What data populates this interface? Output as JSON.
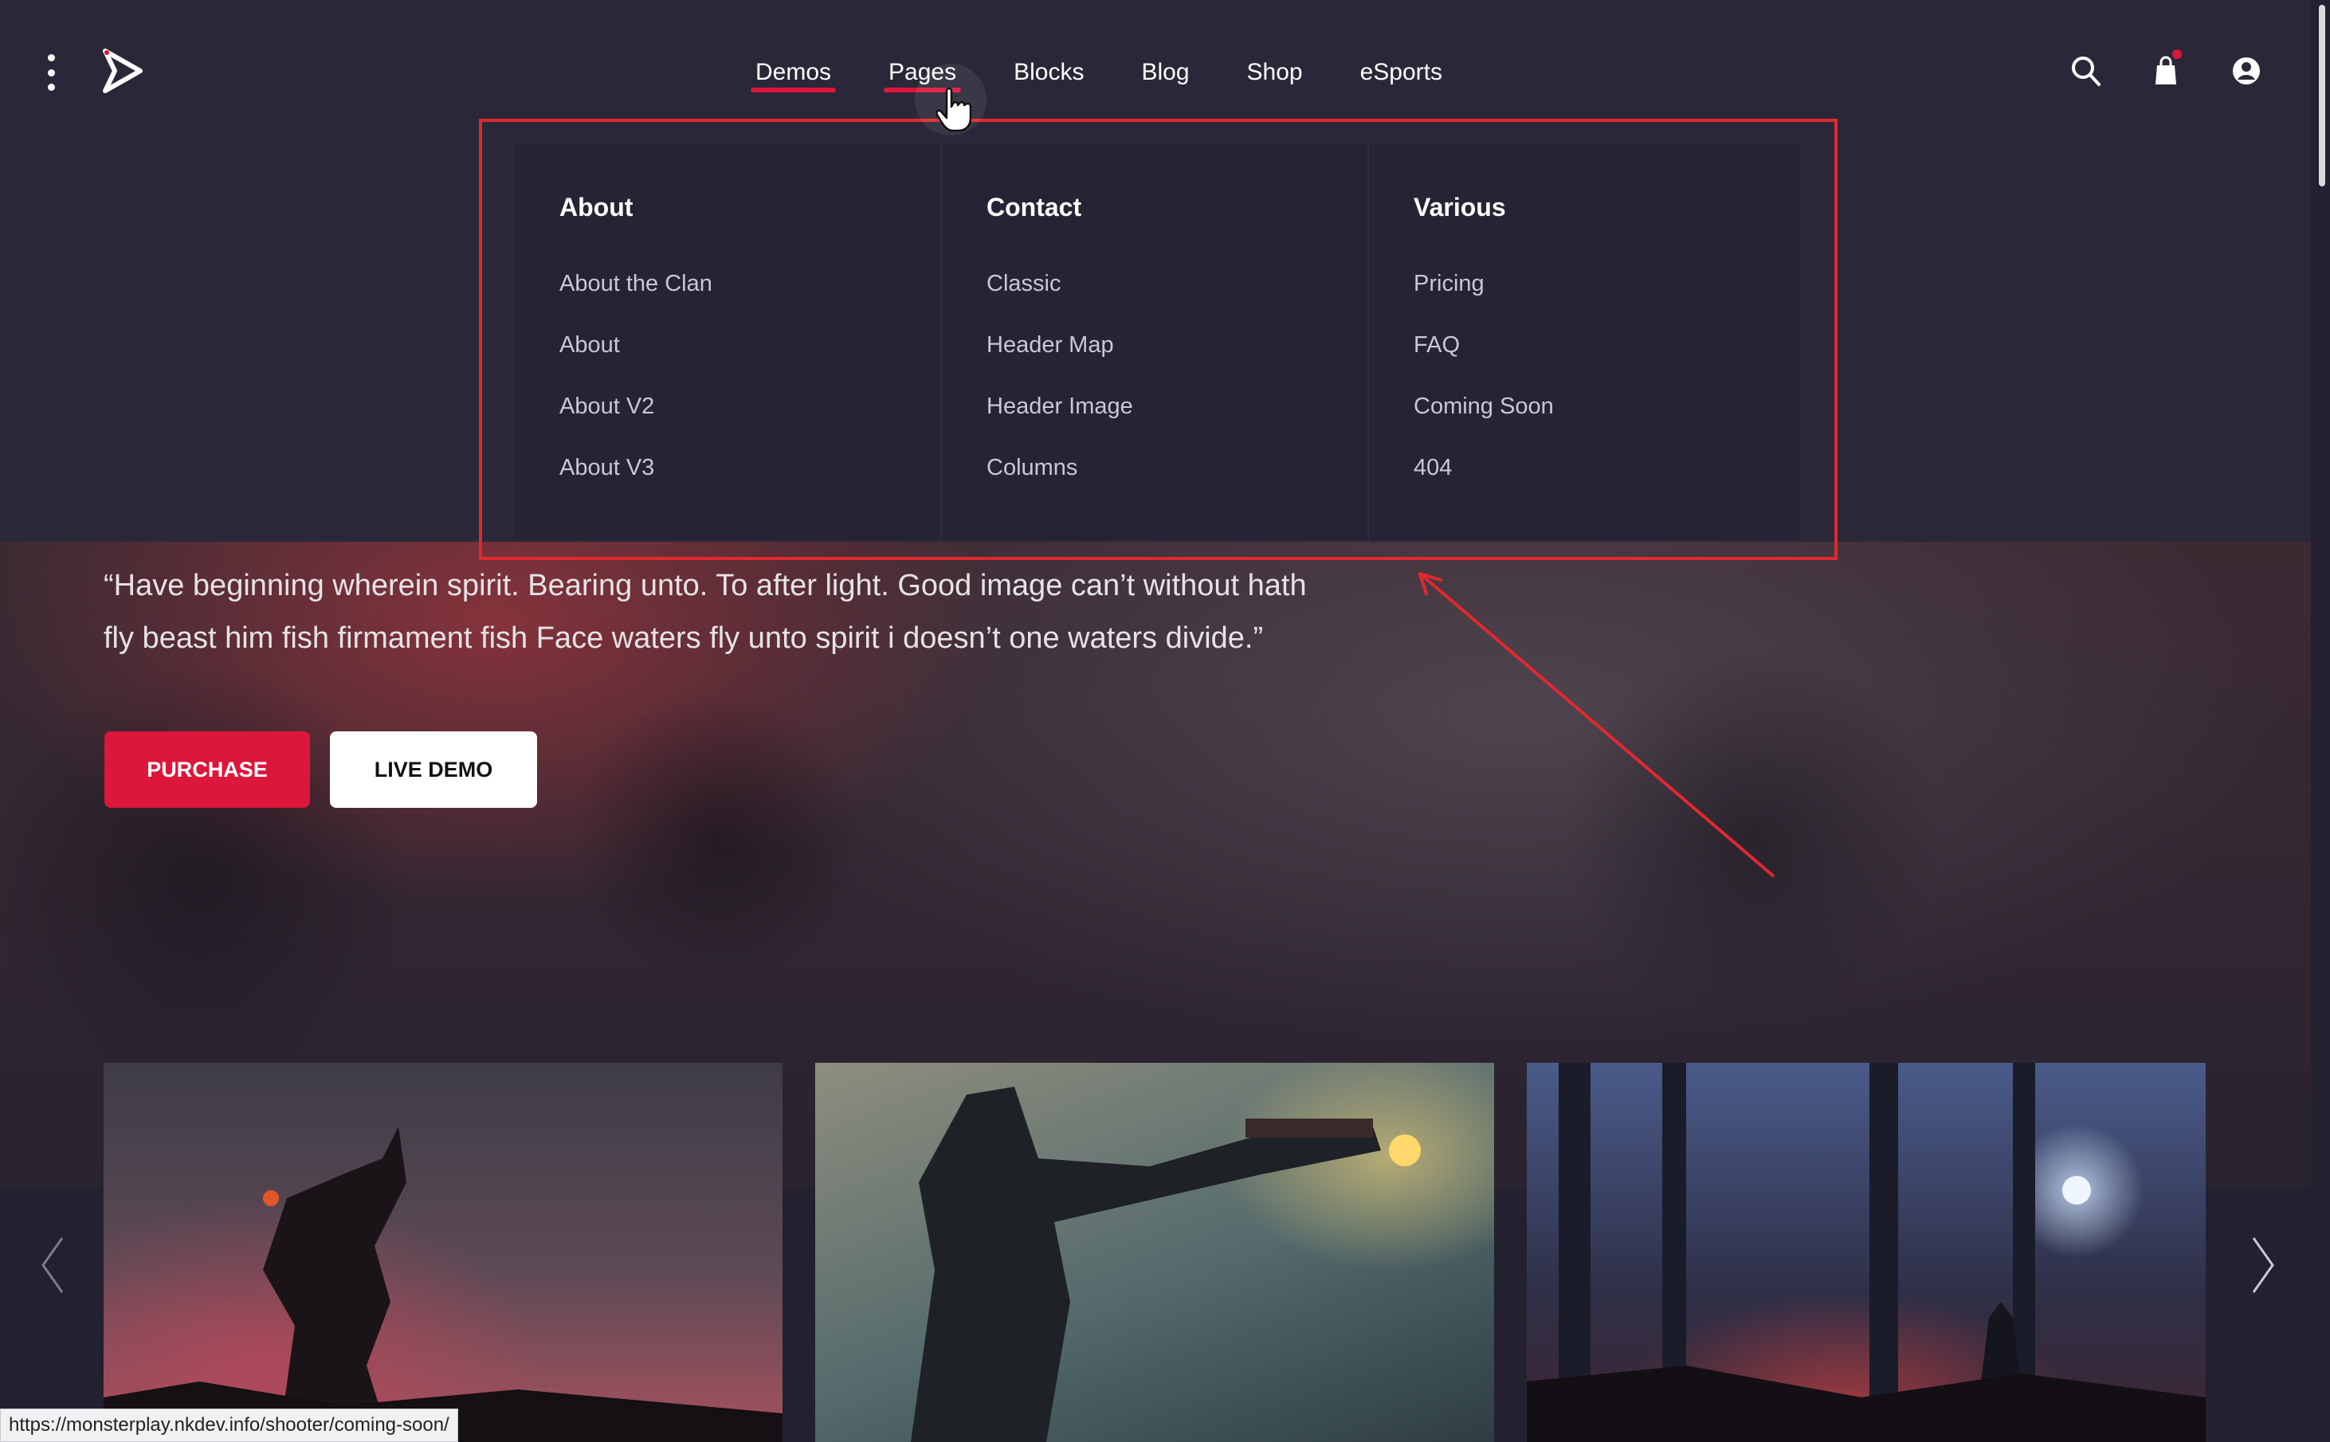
{
  "header": {
    "nav": [
      "Demos",
      "Pages",
      "Blocks",
      "Blog",
      "Shop",
      "eSports"
    ],
    "active_nav": [
      "Demos",
      "Pages"
    ]
  },
  "icons": {
    "menu": "vertical-dots-icon",
    "logo": "play-logo-icon",
    "search": "search-icon",
    "cart": "shopping-bag-icon",
    "account": "user-circle-icon"
  },
  "dropdown": {
    "columns": [
      {
        "title": "About",
        "links": [
          "About the Clan",
          "About",
          "About V2",
          "About V3"
        ]
      },
      {
        "title": "Contact",
        "links": [
          "Classic",
          "Header Map",
          "Header Image",
          "Columns"
        ]
      },
      {
        "title": "Various",
        "links": [
          "Pricing",
          "FAQ",
          "Coming Soon",
          "404"
        ]
      }
    ]
  },
  "hero": {
    "quote_line1": "“Have beginning wherein spirit. Bearing unto. To after light. Good image can’t without hath",
    "quote_line2": "fly beast him fish firmament fish Face waters fly unto spirit i doesn’t one waters divide.”",
    "purchase_label": "PURCHASE",
    "demo_label": "LIVE DEMO"
  },
  "status_bar": {
    "url": "https://monsterplay.nkdev.info/shooter/coming-soon/"
  },
  "colors": {
    "accent": "#dd163b",
    "header_bg": "#2a2838",
    "annotation": "#e2282f"
  }
}
